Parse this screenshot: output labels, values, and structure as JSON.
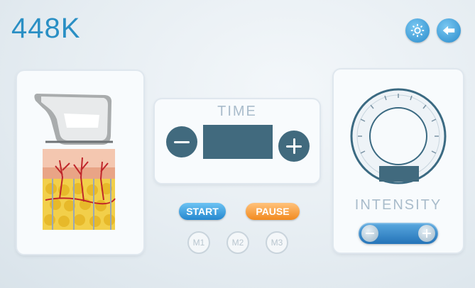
{
  "header": {
    "title": "448K",
    "settings_icon": "gear-icon",
    "back_icon": "back-arrow-icon"
  },
  "time_panel": {
    "label": "TIME",
    "minus_icon": "minus-icon",
    "plus_icon": "plus-icon"
  },
  "controls": {
    "start_label": "START",
    "pause_label": "PAUSE"
  },
  "modes": [
    {
      "label": "M1"
    },
    {
      "label": "M2"
    },
    {
      "label": "M3"
    }
  ],
  "intensity_panel": {
    "label": "INTENSITY"
  },
  "colors": {
    "accent": "#2a8fc4",
    "pause": "#f28a1e",
    "display": "#416a7e"
  }
}
